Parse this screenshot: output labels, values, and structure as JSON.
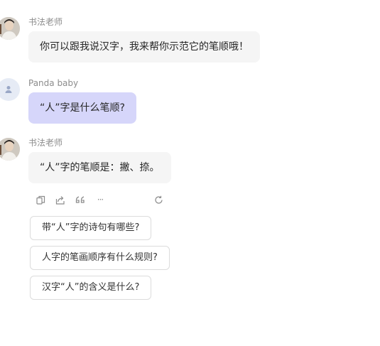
{
  "conversation": {
    "messages": [
      {
        "sender": "书法老师",
        "text": "你可以跟我说汉字，我来帮你示范它的笔顺哦！"
      },
      {
        "sender": "Panda baby",
        "text": "“人”字是什么笔顺?"
      },
      {
        "sender": "书法老师",
        "text": "“人”字的笔顺是：撇、捺。"
      }
    ]
  },
  "message_actions": {
    "icons": [
      "copy-icon",
      "share-icon",
      "quote-icon",
      "more-icon",
      "regenerate-icon"
    ],
    "more_glyph": "···"
  },
  "suggestions": [
    "带“人”字的诗句有哪些?",
    "人字的笔画顺序有什么规则?",
    "汉字“人”的含义是什么?"
  ],
  "colors": {
    "bot_bubble": "#f5f5f5",
    "user_bubble": "#d6d6fa",
    "sender_text": "#8c8c8c"
  }
}
